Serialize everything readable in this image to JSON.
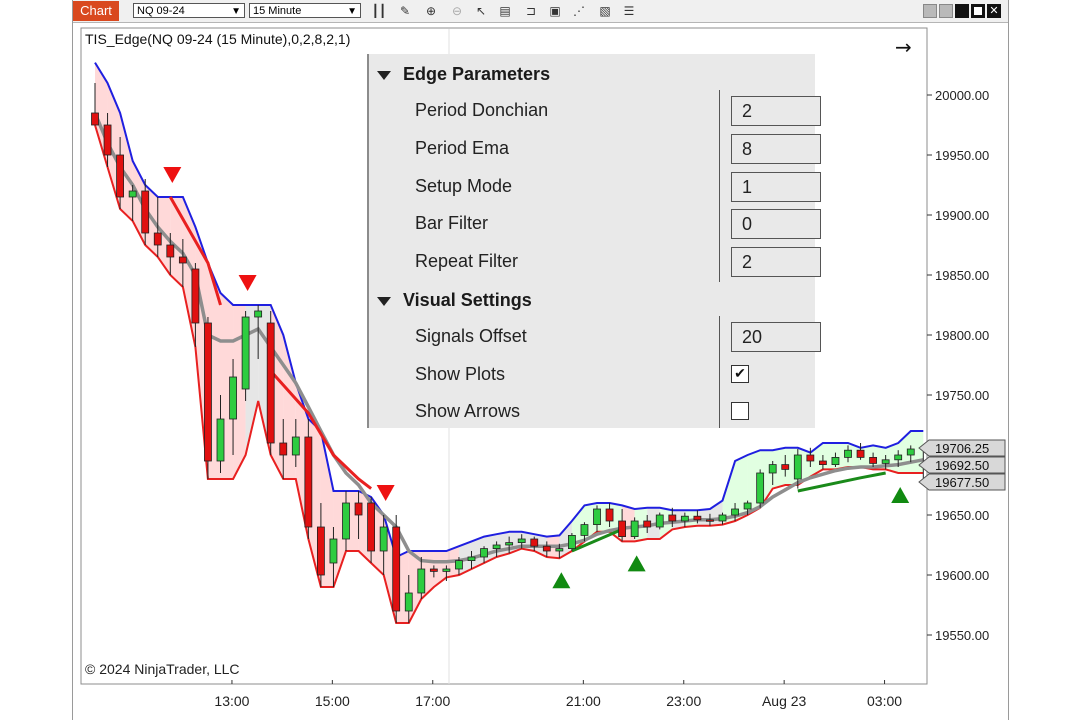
{
  "toolbar": {
    "chart_tab": "Chart",
    "instrument": "NQ 09-24",
    "interval": "15 Minute"
  },
  "chart": {
    "indicator_label": "TIS_Edge(NQ 09-24 (15 Minute),0,2,8,2,1)",
    "copyright": "© 2024 NinjaTrader, LLC",
    "price_badges": [
      "19706.25",
      "19692.50",
      "19677.50"
    ]
  },
  "panel": {
    "section1": "Edge Parameters",
    "section2": "Visual Settings",
    "rows": [
      {
        "label": "Period Donchian",
        "value": "2"
      },
      {
        "label": "Period Ema",
        "value": "8"
      },
      {
        "label": "Setup Mode",
        "value": "1"
      },
      {
        "label": "Bar Filter",
        "value": "0"
      },
      {
        "label": "Repeat Filter",
        "value": "2"
      }
    ],
    "visual_rows": [
      {
        "label": "Signals Offset",
        "value": "20"
      },
      {
        "label": "Show Plots",
        "checked": true
      },
      {
        "label": "Show Arrows",
        "checked": false
      }
    ]
  },
  "chart_data": {
    "type": "candlestick",
    "y_ticks": [
      20000.0,
      19950.0,
      19900.0,
      19850.0,
      19800.0,
      19750.0,
      19700.0,
      19650.0,
      19600.0,
      19550.0
    ],
    "y_tick_labels": [
      "20000.00",
      "19950.00",
      "19900.00",
      "19850.00",
      "19800.00",
      "19750.00",
      "19700.00",
      "19650.00",
      "19600.00",
      "19550.00"
    ],
    "ylim": [
      19515,
      20040
    ],
    "x_tick_labels": [
      "13:00",
      "15:00",
      "17:00",
      "21:00",
      "23:00",
      "Aug 23",
      "03:00"
    ],
    "x_tick_bar_index": [
      9,
      17,
      25,
      37,
      45,
      53,
      61
    ],
    "bars_count": 67,
    "candles": [
      [
        19985,
        20010,
        19985,
        19975
      ],
      [
        19975,
        19985,
        19940,
        19950
      ],
      [
        19950,
        19965,
        19905,
        19915
      ],
      [
        19915,
        19925,
        19895,
        19920
      ],
      [
        19920,
        19930,
        19875,
        19885
      ],
      [
        19885,
        19915,
        19865,
        19875
      ],
      [
        19875,
        19885,
        19850,
        19865
      ],
      [
        19865,
        19880,
        19840,
        19860
      ],
      [
        19855,
        19860,
        19790,
        19810
      ],
      [
        19810,
        19815,
        19680,
        19695
      ],
      [
        19695,
        19750,
        19685,
        19730
      ],
      [
        19730,
        19780,
        19700,
        19765
      ],
      [
        19755,
        19820,
        19745,
        19815
      ],
      [
        19815,
        19825,
        19780,
        19820
      ],
      [
        19810,
        19820,
        19700,
        19710
      ],
      [
        19710,
        19730,
        19680,
        19700
      ],
      [
        19700,
        19730,
        19690,
        19715
      ],
      [
        19715,
        19730,
        19630,
        19640
      ],
      [
        19640,
        19660,
        19590,
        19600
      ],
      [
        19610,
        19640,
        19590,
        19630
      ],
      [
        19630,
        19670,
        19620,
        19660
      ],
      [
        19660,
        19670,
        19630,
        19650
      ],
      [
        19660,
        19665,
        19610,
        19620
      ],
      [
        19620,
        19650,
        19600,
        19640
      ],
      [
        19640,
        19650,
        19560,
        19570
      ],
      [
        19570,
        19600,
        19560,
        19585
      ],
      [
        19585,
        19615,
        19580,
        19605
      ],
      [
        19605,
        19608,
        19598,
        19603
      ],
      [
        19603,
        19608,
        19595,
        19605
      ],
      [
        19605,
        19615,
        19600,
        19612
      ],
      [
        19612,
        19620,
        19605,
        19615
      ],
      [
        19615,
        19624,
        19610,
        19622
      ],
      [
        19622,
        19628,
        19615,
        19625
      ],
      [
        19625,
        19632,
        19618,
        19627
      ],
      [
        19627,
        19634,
        19622,
        19630
      ],
      [
        19630,
        19632,
        19620,
        19624
      ],
      [
        19624,
        19628,
        19615,
        19620
      ],
      [
        19620,
        19626,
        19614,
        19622
      ],
      [
        19622,
        19635,
        19620,
        19633
      ],
      [
        19633,
        19644,
        19628,
        19642
      ],
      [
        19642,
        19658,
        19636,
        19655
      ],
      [
        19655,
        19660,
        19640,
        19645
      ],
      [
        19645,
        19655,
        19628,
        19632
      ],
      [
        19632,
        19648,
        19630,
        19645
      ],
      [
        19645,
        19650,
        19635,
        19640
      ],
      [
        19640,
        19652,
        19638,
        19650
      ],
      [
        19650,
        19656,
        19640,
        19645
      ],
      [
        19645,
        19652,
        19640,
        19649
      ],
      [
        19649,
        19654,
        19643,
        19646
      ],
      [
        19646,
        19651,
        19641,
        19645
      ],
      [
        19645,
        19652,
        19642,
        19650
      ],
      [
        19650,
        19660,
        19645,
        19655
      ],
      [
        19655,
        19662,
        19650,
        19660
      ],
      [
        19660,
        19688,
        19656,
        19685
      ],
      [
        19685,
        19695,
        19675,
        19692
      ],
      [
        19692,
        19700,
        19682,
        19688
      ],
      [
        19680,
        19705,
        19672,
        19700
      ],
      [
        19700,
        19706,
        19690,
        19695
      ],
      [
        19695,
        19700,
        19688,
        19692
      ],
      [
        19692,
        19702,
        19690,
        19698
      ],
      [
        19698,
        19708,
        19694,
        19704
      ],
      [
        19704,
        19710,
        19696,
        19698
      ],
      [
        19698,
        19702,
        19690,
        19693
      ],
      [
        19693,
        19700,
        19688,
        19696
      ],
      [
        19696,
        19704,
        19690,
        19700
      ],
      [
        19700,
        19708,
        19694,
        19705
      ],
      [
        19692,
        19706,
        19680,
        19692
      ]
    ],
    "upper_band": [
      20027,
      20010,
      19985,
      19945,
      19925,
      19915,
      19915,
      19915,
      19890,
      19860,
      19835,
      19825,
      19825,
      19825,
      19825,
      19800,
      19760,
      19730,
      19720,
      19670,
      19670,
      19670,
      19665,
      19650,
      19615,
      19620,
      19620,
      19620,
      19620,
      19624,
      19628,
      19632,
      19634,
      19636,
      19636,
      19634,
      19632,
      19633,
      19645,
      19658,
      19660,
      19660,
      19658,
      19655,
      19656,
      19656,
      19654,
      19654,
      19654,
      19655,
      19662,
      19695,
      19700,
      19704,
      19704,
      19706,
      19706,
      19702,
      19710,
      19710,
      19710,
      19706,
      19708,
      19706,
      19710,
      19720,
      19720
    ],
    "lower_band": [
      19975,
      19940,
      19905,
      19895,
      19875,
      19865,
      19850,
      19840,
      19790,
      19680,
      19680,
      19680,
      19700,
      19745,
      19700,
      19680,
      19680,
      19630,
      19590,
      19590,
      19620,
      19620,
      19610,
      19600,
      19560,
      19560,
      19580,
      19590,
      19598,
      19600,
      19605,
      19610,
      19615,
      19618,
      19622,
      19620,
      19615,
      19614,
      19620,
      19628,
      19636,
      19636,
      19628,
      19628,
      19630,
      19630,
      19638,
      19640,
      19641,
      19641,
      19642,
      19645,
      19650,
      19656,
      19672,
      19675,
      19675,
      19682,
      19688,
      19688,
      19690,
      19690,
      19688,
      19688,
      19685,
      19685,
      19685
    ],
    "ema": [
      19985,
      19960,
      19940,
      19925,
      19905,
      19890,
      19878,
      19868,
      19850,
      19800,
      19795,
      19795,
      19800,
      19805,
      19790,
      19775,
      19760,
      19740,
      19720,
      19700,
      19685,
      19675,
      19660,
      19650,
      19640,
      19620,
      19612,
      19611,
      19611,
      19612,
      19614,
      19617,
      19620,
      19622,
      19624,
      19624,
      19624,
      19624,
      19626,
      19629,
      19634,
      19637,
      19639,
      19640,
      19641,
      19643,
      19644,
      19645,
      19646,
      19646,
      19647,
      19649,
      19652,
      19657,
      19665,
      19671,
      19677,
      19681,
      19684,
      19687,
      19689,
      19690,
      19690,
      19691,
      19692,
      19694,
      19696
    ],
    "sell_signals": [
      8,
      15,
      29
    ],
    "buy_signals": [
      53,
      60,
      72
    ],
    "buy_signal_bars": [
      37,
      43,
      64
    ],
    "sell_signal_bars": [
      6,
      12,
      23
    ]
  }
}
